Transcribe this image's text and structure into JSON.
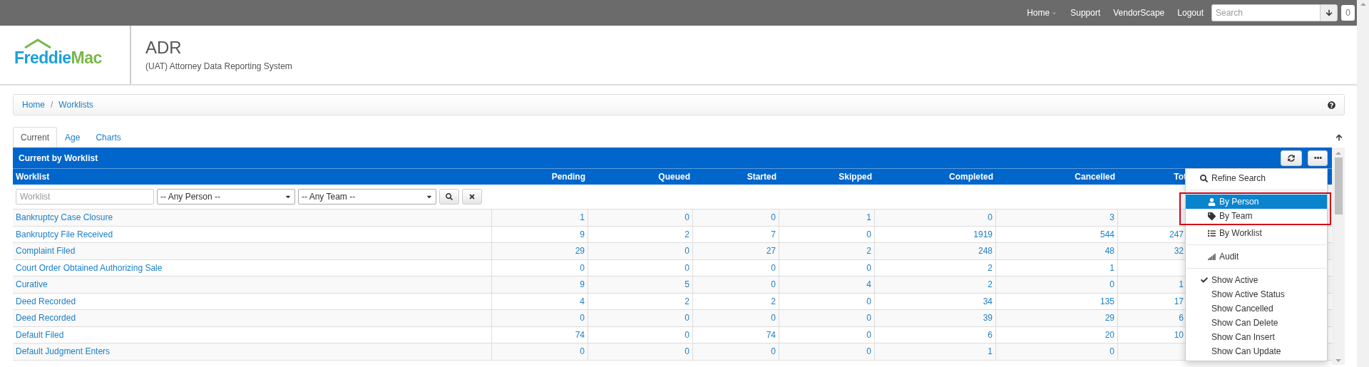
{
  "top_nav": {
    "links": [
      {
        "label": "Home",
        "dropdown": true
      },
      {
        "label": "Support",
        "dropdown": false
      },
      {
        "label": "VendorScape",
        "dropdown": false
      },
      {
        "label": "Logout",
        "dropdown": false
      }
    ],
    "search": {
      "placeholder": "Search"
    },
    "badge": "0"
  },
  "header": {
    "logo": {
      "first": "Freddie",
      "second": "Mac"
    },
    "title": "ADR",
    "subtitle": "(UAT) Attorney Data Reporting System"
  },
  "breadcrumb": {
    "items": [
      "Home",
      "Worklists"
    ],
    "separator": "/"
  },
  "tabs": [
    {
      "label": "Current",
      "selected": true
    },
    {
      "label": "Age",
      "selected": false
    },
    {
      "label": "Charts",
      "selected": false
    }
  ],
  "panel": {
    "title": "Current by Worklist",
    "columns": [
      "Worklist",
      "Pending",
      "Queued",
      "Started",
      "Skipped",
      "Completed",
      "Cancelled",
      "Tot"
    ],
    "filters": {
      "worklist_placeholder": "Worklist",
      "person": "-- Any Person --",
      "team": "-- Any Team --"
    },
    "rows": [
      {
        "worklist": "Bankruptcy Case Closure",
        "values": [
          "1",
          "0",
          "0",
          "1",
          "0",
          "3"
        ]
      },
      {
        "worklist": "Bankruptcy File Received",
        "values": [
          "9",
          "2",
          "7",
          "0",
          "1919",
          "544"
        ],
        "total": "247"
      },
      {
        "worklist": "Complaint Filed",
        "values": [
          "29",
          "0",
          "27",
          "2",
          "248",
          "48"
        ],
        "total": "32"
      },
      {
        "worklist": "Court Order Obtained Authorizing Sale",
        "values": [
          "0",
          "0",
          "0",
          "0",
          "2",
          "1"
        ]
      },
      {
        "worklist": "Curative",
        "values": [
          "9",
          "5",
          "0",
          "4",
          "2",
          "0"
        ],
        "total": "1"
      },
      {
        "worklist": "Deed Recorded",
        "values": [
          "4",
          "2",
          "2",
          "0",
          "34",
          "135"
        ],
        "total": "17"
      },
      {
        "worklist": "Deed Recorded",
        "values": [
          "0",
          "0",
          "0",
          "0",
          "39",
          "29"
        ],
        "total": "6"
      },
      {
        "worklist": "Default Filed",
        "values": [
          "74",
          "0",
          "74",
          "0",
          "6",
          "20"
        ],
        "total": "10"
      },
      {
        "worklist": "Default Judgment Enters",
        "values": [
          "0",
          "0",
          "0",
          "0",
          "1",
          "0"
        ]
      }
    ]
  },
  "menu": {
    "items": [
      {
        "kind": "action",
        "label": "Refine Search",
        "selected": false,
        "framed": false
      },
      {
        "kind": "divider"
      },
      {
        "kind": "action",
        "label": "By Person",
        "selected": true,
        "framed": true
      },
      {
        "kind": "action",
        "label": "By Team",
        "selected": false,
        "framed": true
      },
      {
        "kind": "action",
        "label": "By Worklist",
        "selected": false,
        "framed": false
      },
      {
        "kind": "divider"
      },
      {
        "kind": "action",
        "label": "Audit",
        "selected": false,
        "framed": false
      },
      {
        "kind": "divider"
      },
      {
        "kind": "toggle",
        "label": "Show Active",
        "checked": true
      },
      {
        "kind": "toggle",
        "label": "Show Active Status",
        "checked": false
      },
      {
        "kind": "toggle",
        "label": "Show Cancelled",
        "checked": false
      },
      {
        "kind": "toggle",
        "label": "Show Can Delete",
        "checked": false
      },
      {
        "kind": "toggle",
        "label": "Show Can Insert",
        "checked": false
      },
      {
        "kind": "toggle",
        "label": "Show Can Update",
        "checked": false
      }
    ]
  }
}
